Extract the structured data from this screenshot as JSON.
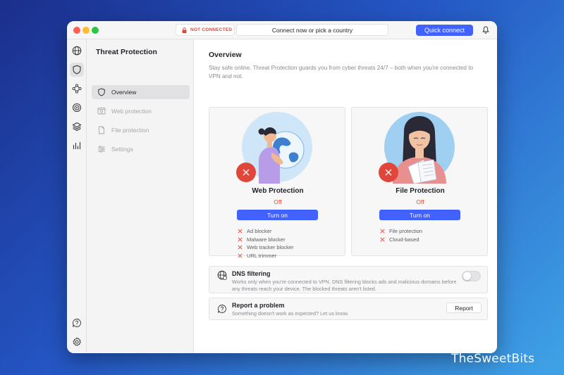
{
  "titlebar": {
    "status_label": "NOT CONNECTED",
    "connect_placeholder": "Connect now or pick a country",
    "quick_connect_label": "Quick connect"
  },
  "sidebar_icons": [
    "globe-icon",
    "shield-icon",
    "meshnet-icon",
    "target-icon",
    "layers-icon",
    "stats-icon",
    "help-icon",
    "settings-icon"
  ],
  "subnav": {
    "title": "Threat Protection",
    "items": [
      {
        "label": "Overview",
        "state": "active"
      },
      {
        "label": "Web protection",
        "state": "disabled"
      },
      {
        "label": "File protection",
        "state": "disabled"
      },
      {
        "label": "Settings",
        "state": "disabled"
      }
    ]
  },
  "main": {
    "title": "Overview",
    "description": "Stay safe online. Threat Protection guards you from cyber threats 24/7 – both when you're connected to VPN and not.",
    "cards": [
      {
        "title": "Web Protection",
        "status": "Off",
        "button_label": "Turn on",
        "features": [
          "Ad blocker",
          "Malware blocker",
          "Web tracker blocker",
          "URL trimmer"
        ]
      },
      {
        "title": "File Protection",
        "status": "Off",
        "button_label": "Turn on",
        "features": [
          "File protection",
          "Cloud-based"
        ]
      }
    ],
    "dns": {
      "title": "DNS filtering",
      "description": "Works only when you're connected to VPN. DNS filtering blocks ads and malicious domains before any threats reach your device. The blocked threats aren't listed.",
      "enabled": false
    },
    "report": {
      "title": "Report a problem",
      "description": "Something doesn't work as expected? Let us know.",
      "button_label": "Report"
    }
  },
  "watermark": "TheSweetBits",
  "colors": {
    "accent": "#4262ff",
    "danger": "#e0463a",
    "illustration_bg": "#bfe0f7"
  }
}
